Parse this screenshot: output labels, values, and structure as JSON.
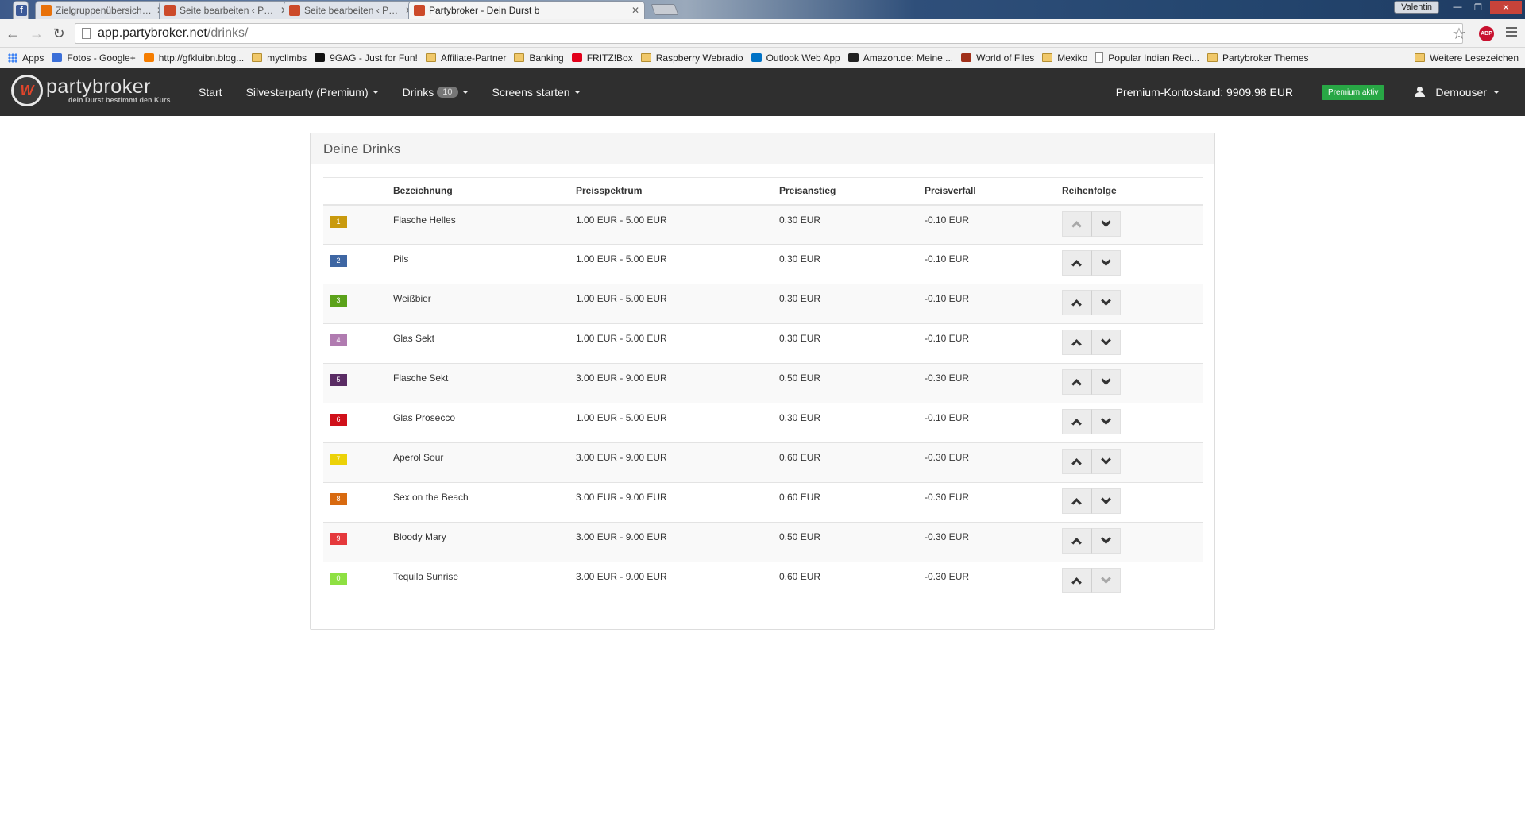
{
  "browser": {
    "tabs": [
      {
        "title": "Zielgruppenübersicht - Go",
        "favicon_color": "#e8710a",
        "active": false
      },
      {
        "title": "Seite bearbeiten ‹ Partybr",
        "favicon_color": "#cc4a2a",
        "active": false
      },
      {
        "title": "Seite bearbeiten ‹ Partybr",
        "favicon_color": "#cc4a2a",
        "active": false
      },
      {
        "title": "Partybroker - Dein Durst b",
        "favicon_color": "#cc4a2a",
        "active": true
      }
    ],
    "facebook_tab_icon": "facebook-icon",
    "user_button": "Valentin",
    "url_host": "app.partybroker.net",
    "url_path": "/drinks/",
    "extension": "ABP",
    "bookmarks": [
      {
        "label": "Apps",
        "icon": "apps-icon"
      },
      {
        "label": "Fotos - Google+",
        "icon": "google-plus-icon"
      },
      {
        "label": "http://gfkluibn.blog...",
        "icon": "blogger-icon"
      },
      {
        "label": "myclimbs",
        "icon": "folder-icon"
      },
      {
        "label": "9GAG - Just for Fun!",
        "icon": "9gag-icon"
      },
      {
        "label": "Affiliate-Partner",
        "icon": "folder-icon"
      },
      {
        "label": "Banking",
        "icon": "folder-icon"
      },
      {
        "label": "FRITZ!Box",
        "icon": "fritzbox-icon"
      },
      {
        "label": "Raspberry Webradio",
        "icon": "folder-icon"
      },
      {
        "label": "Outlook Web App",
        "icon": "outlook-icon"
      },
      {
        "label": "Amazon.de: Meine ...",
        "icon": "amazon-icon"
      },
      {
        "label": "World of Files",
        "icon": "world-of-files-icon"
      },
      {
        "label": "Mexiko",
        "icon": "folder-icon"
      },
      {
        "label": "Popular Indian Reci...",
        "icon": "page-icon"
      },
      {
        "label": "Partybroker Themes",
        "icon": "folder-icon"
      }
    ],
    "other_bookmarks": "Weitere Lesezeichen"
  },
  "navbar": {
    "logo_name": "partybroker",
    "logo_tagline": "dein Durst bestimmt den Kurs",
    "items": {
      "start": "Start",
      "party": "Silvesterparty (Premium)",
      "drinks": "Drinks",
      "drinks_count": "10",
      "screens": "Screens starten"
    },
    "premium_balance": "Premium-Kontostand: 9909.98 EUR",
    "premium_badge": "Premium aktiv",
    "user": "Demouser"
  },
  "panel": {
    "title": "Deine Drinks",
    "columns": {
      "name": "Bezeichnung",
      "range": "Preisspektrum",
      "rise": "Preisanstieg",
      "fall": "Preisverfall",
      "order": "Reihenfolge"
    },
    "drinks": [
      {
        "num": "1",
        "color": "#c99a0e",
        "name": "Flasche Helles",
        "range": "1.00 EUR - 5.00 EUR",
        "rise": "0.30 EUR",
        "fall": "-0.10 EUR",
        "up_enabled": false,
        "down_enabled": true
      },
      {
        "num": "2",
        "color": "#3e66a3",
        "name": "Pils",
        "range": "1.00 EUR - 5.00 EUR",
        "rise": "0.30 EUR",
        "fall": "-0.10 EUR",
        "up_enabled": true,
        "down_enabled": true
      },
      {
        "num": "3",
        "color": "#5ba21a",
        "name": "Weißbier",
        "range": "1.00 EUR - 5.00 EUR",
        "rise": "0.30 EUR",
        "fall": "-0.10 EUR",
        "up_enabled": true,
        "down_enabled": true
      },
      {
        "num": "4",
        "color": "#b07bb0",
        "name": "Glas Sekt",
        "range": "1.00 EUR - 5.00 EUR",
        "rise": "0.30 EUR",
        "fall": "-0.10 EUR",
        "up_enabled": true,
        "down_enabled": true
      },
      {
        "num": "5",
        "color": "#5a2c64",
        "name": "Flasche Sekt",
        "range": "3.00 EUR - 9.00 EUR",
        "rise": "0.50 EUR",
        "fall": "-0.30 EUR",
        "up_enabled": true,
        "down_enabled": true
      },
      {
        "num": "6",
        "color": "#d0101a",
        "name": "Glas Prosecco",
        "range": "1.00 EUR - 5.00 EUR",
        "rise": "0.30 EUR",
        "fall": "-0.10 EUR",
        "up_enabled": true,
        "down_enabled": true
      },
      {
        "num": "7",
        "color": "#ecd208",
        "name": "Aperol Sour",
        "range": "3.00 EUR - 9.00 EUR",
        "rise": "0.60 EUR",
        "fall": "-0.30 EUR",
        "up_enabled": true,
        "down_enabled": true
      },
      {
        "num": "8",
        "color": "#d86a10",
        "name": "Sex on the Beach",
        "range": "3.00 EUR - 9.00 EUR",
        "rise": "0.60 EUR",
        "fall": "-0.30 EUR",
        "up_enabled": true,
        "down_enabled": true
      },
      {
        "num": "9",
        "color": "#e5393c",
        "name": "Bloody Mary",
        "range": "3.00 EUR - 9.00 EUR",
        "rise": "0.50 EUR",
        "fall": "-0.30 EUR",
        "up_enabled": true,
        "down_enabled": true
      },
      {
        "num": "0",
        "color": "#8ee042",
        "name": "Tequila Sunrise",
        "range": "3.00 EUR - 9.00 EUR",
        "rise": "0.60 EUR",
        "fall": "-0.30 EUR",
        "up_enabled": true,
        "down_enabled": false
      }
    ]
  }
}
